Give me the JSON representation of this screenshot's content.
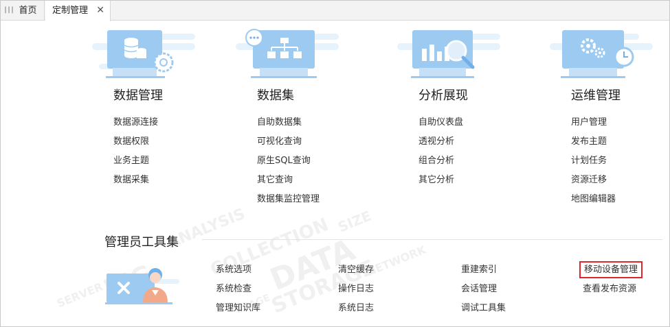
{
  "tabs": [
    {
      "label": "首页"
    },
    {
      "label": "定制管理",
      "close": "✕"
    }
  ],
  "categories": [
    {
      "title": "数据管理",
      "icon": "database-gear-icon",
      "items": [
        "数据源连接",
        "数据权限",
        "业务主题",
        "数据采集"
      ]
    },
    {
      "title": "数据集",
      "icon": "dataset-tree-icon",
      "items": [
        "自助数据集",
        "可视化查询",
        "原生SQL查询",
        "其它查询",
        "数据集监控管理"
      ]
    },
    {
      "title": "分析展现",
      "icon": "chart-magnifier-icon",
      "items": [
        "自助仪表盘",
        "透视分析",
        "组合分析",
        "其它分析"
      ]
    },
    {
      "title": "运维管理",
      "icon": "gears-clock-icon",
      "items": [
        "用户管理",
        "发布主题",
        "计划任务",
        "资源迁移",
        "地图编辑器"
      ]
    }
  ],
  "admin": {
    "title": "管理员工具集",
    "columns": [
      [
        "系统选项",
        "系统检查",
        "管理知识库"
      ],
      [
        "清空缓存",
        "操作日志",
        "系统日志"
      ],
      [
        "重建索引",
        "会话管理",
        "调试工具集"
      ],
      [
        "移动设备管理",
        "查看发布资源"
      ]
    ],
    "highlighted": "移动设备管理",
    "highlight_color": "#e0262b"
  },
  "colors": {
    "illustration_blue": "#9ccaf0",
    "illustration_light": "#e6f2fc",
    "illustration_dark": "#6fb0e8"
  }
}
